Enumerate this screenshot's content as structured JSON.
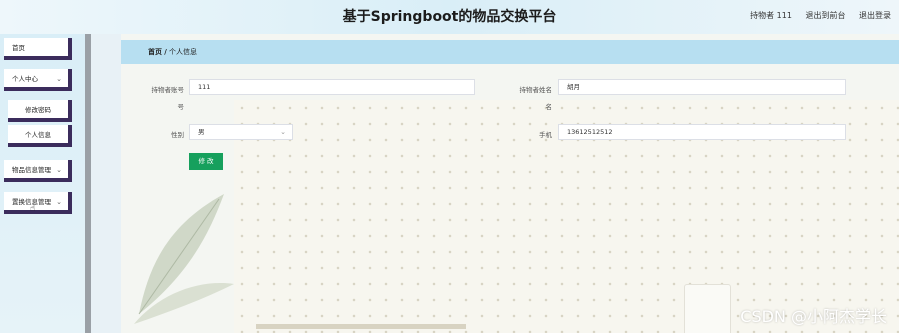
{
  "header": {
    "title": "基于Springboot的物品交换平台",
    "user_label": "持物者 111",
    "front_link": "退出到前台",
    "logout_link": "退出登录"
  },
  "sidebar": {
    "items": [
      {
        "label": "首页"
      },
      {
        "label": "个人中心",
        "caret": "⌄"
      },
      {
        "label": "修改密码"
      },
      {
        "label": "个人信息"
      },
      {
        "label": "物品信息管理",
        "caret": "⌄"
      },
      {
        "label": "置换信息管理",
        "caret": "⌄"
      }
    ]
  },
  "breadcrumb": {
    "home": "首页",
    "sep": "/",
    "current": "个人信息"
  },
  "form": {
    "account_label": "持物者账号",
    "account_value": "111",
    "name_label": "持物者姓名",
    "name_value": "胡月",
    "gender_label": "性别",
    "gender_value": "男",
    "phone_label": "手机",
    "phone_value": "13612512512",
    "submit_label": "修 改"
  },
  "watermark": "CSDN @小阿杰学长",
  "colors": {
    "accent": "#16a05d",
    "breadcrumb_bg": "#b7dff1",
    "sidebar_border": "#3b2c5c"
  }
}
